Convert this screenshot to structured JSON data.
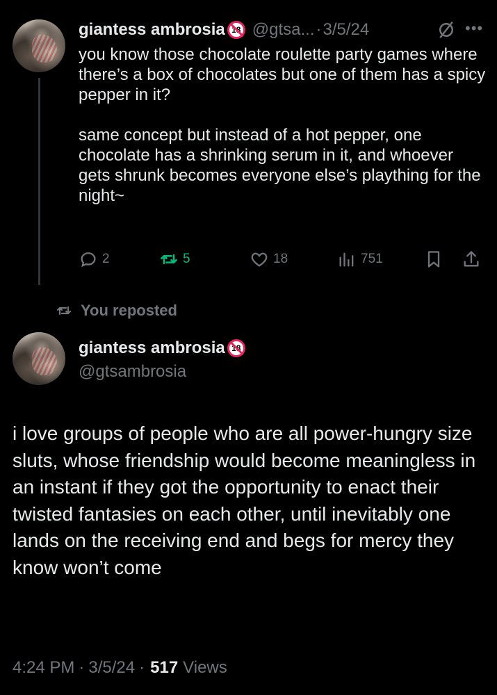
{
  "thread_tweet": {
    "display_name": "giantess ambrosia",
    "badge": "18",
    "handle": "@gtsa...",
    "separator": "·",
    "date": "3/5/24",
    "paragraphs": [
      "you know those chocolate roulette party games where there’s a box of chocolates but one of them has a spicy pepper in it?",
      "same concept but instead of a hot pepper, one chocolate has a shrinking serum in it, and whoever gets shrunk becomes everyone else’s plaything for the night~"
    ],
    "actions": {
      "replies": "2",
      "reposts": "5",
      "likes": "18",
      "views": "751"
    },
    "icons": {
      "reply": "reply-icon",
      "repost": "repost-icon",
      "like": "heart-icon",
      "views": "views-icon",
      "bookmark": "bookmark-icon",
      "share": "share-icon",
      "grok": "grok-icon",
      "more": "more-icon"
    },
    "colors": {
      "repost_active": "#00ba7c",
      "muted": "#71767b"
    }
  },
  "repost_label": "You reposted",
  "main_tweet": {
    "display_name": "giantess ambrosia",
    "badge": "18",
    "handle": "@gtsambrosia",
    "text": "i love groups of people who are all power-hungry size sluts, whose friendship would become meaningless in an instant if they got the opportunity to enact their twisted fantasies on each other, until inevitably one lands on the receiving end and begs for mercy they know won’t come",
    "time": "4:24 PM",
    "separator": "·",
    "date": "3/5/24",
    "views_count": "517",
    "views_label": "Views"
  },
  "theme": {
    "background": "#000000",
    "text": "#e7e9ea",
    "muted": "#71767b",
    "thread_line": "#333639",
    "badge_red": "#e0245e"
  }
}
